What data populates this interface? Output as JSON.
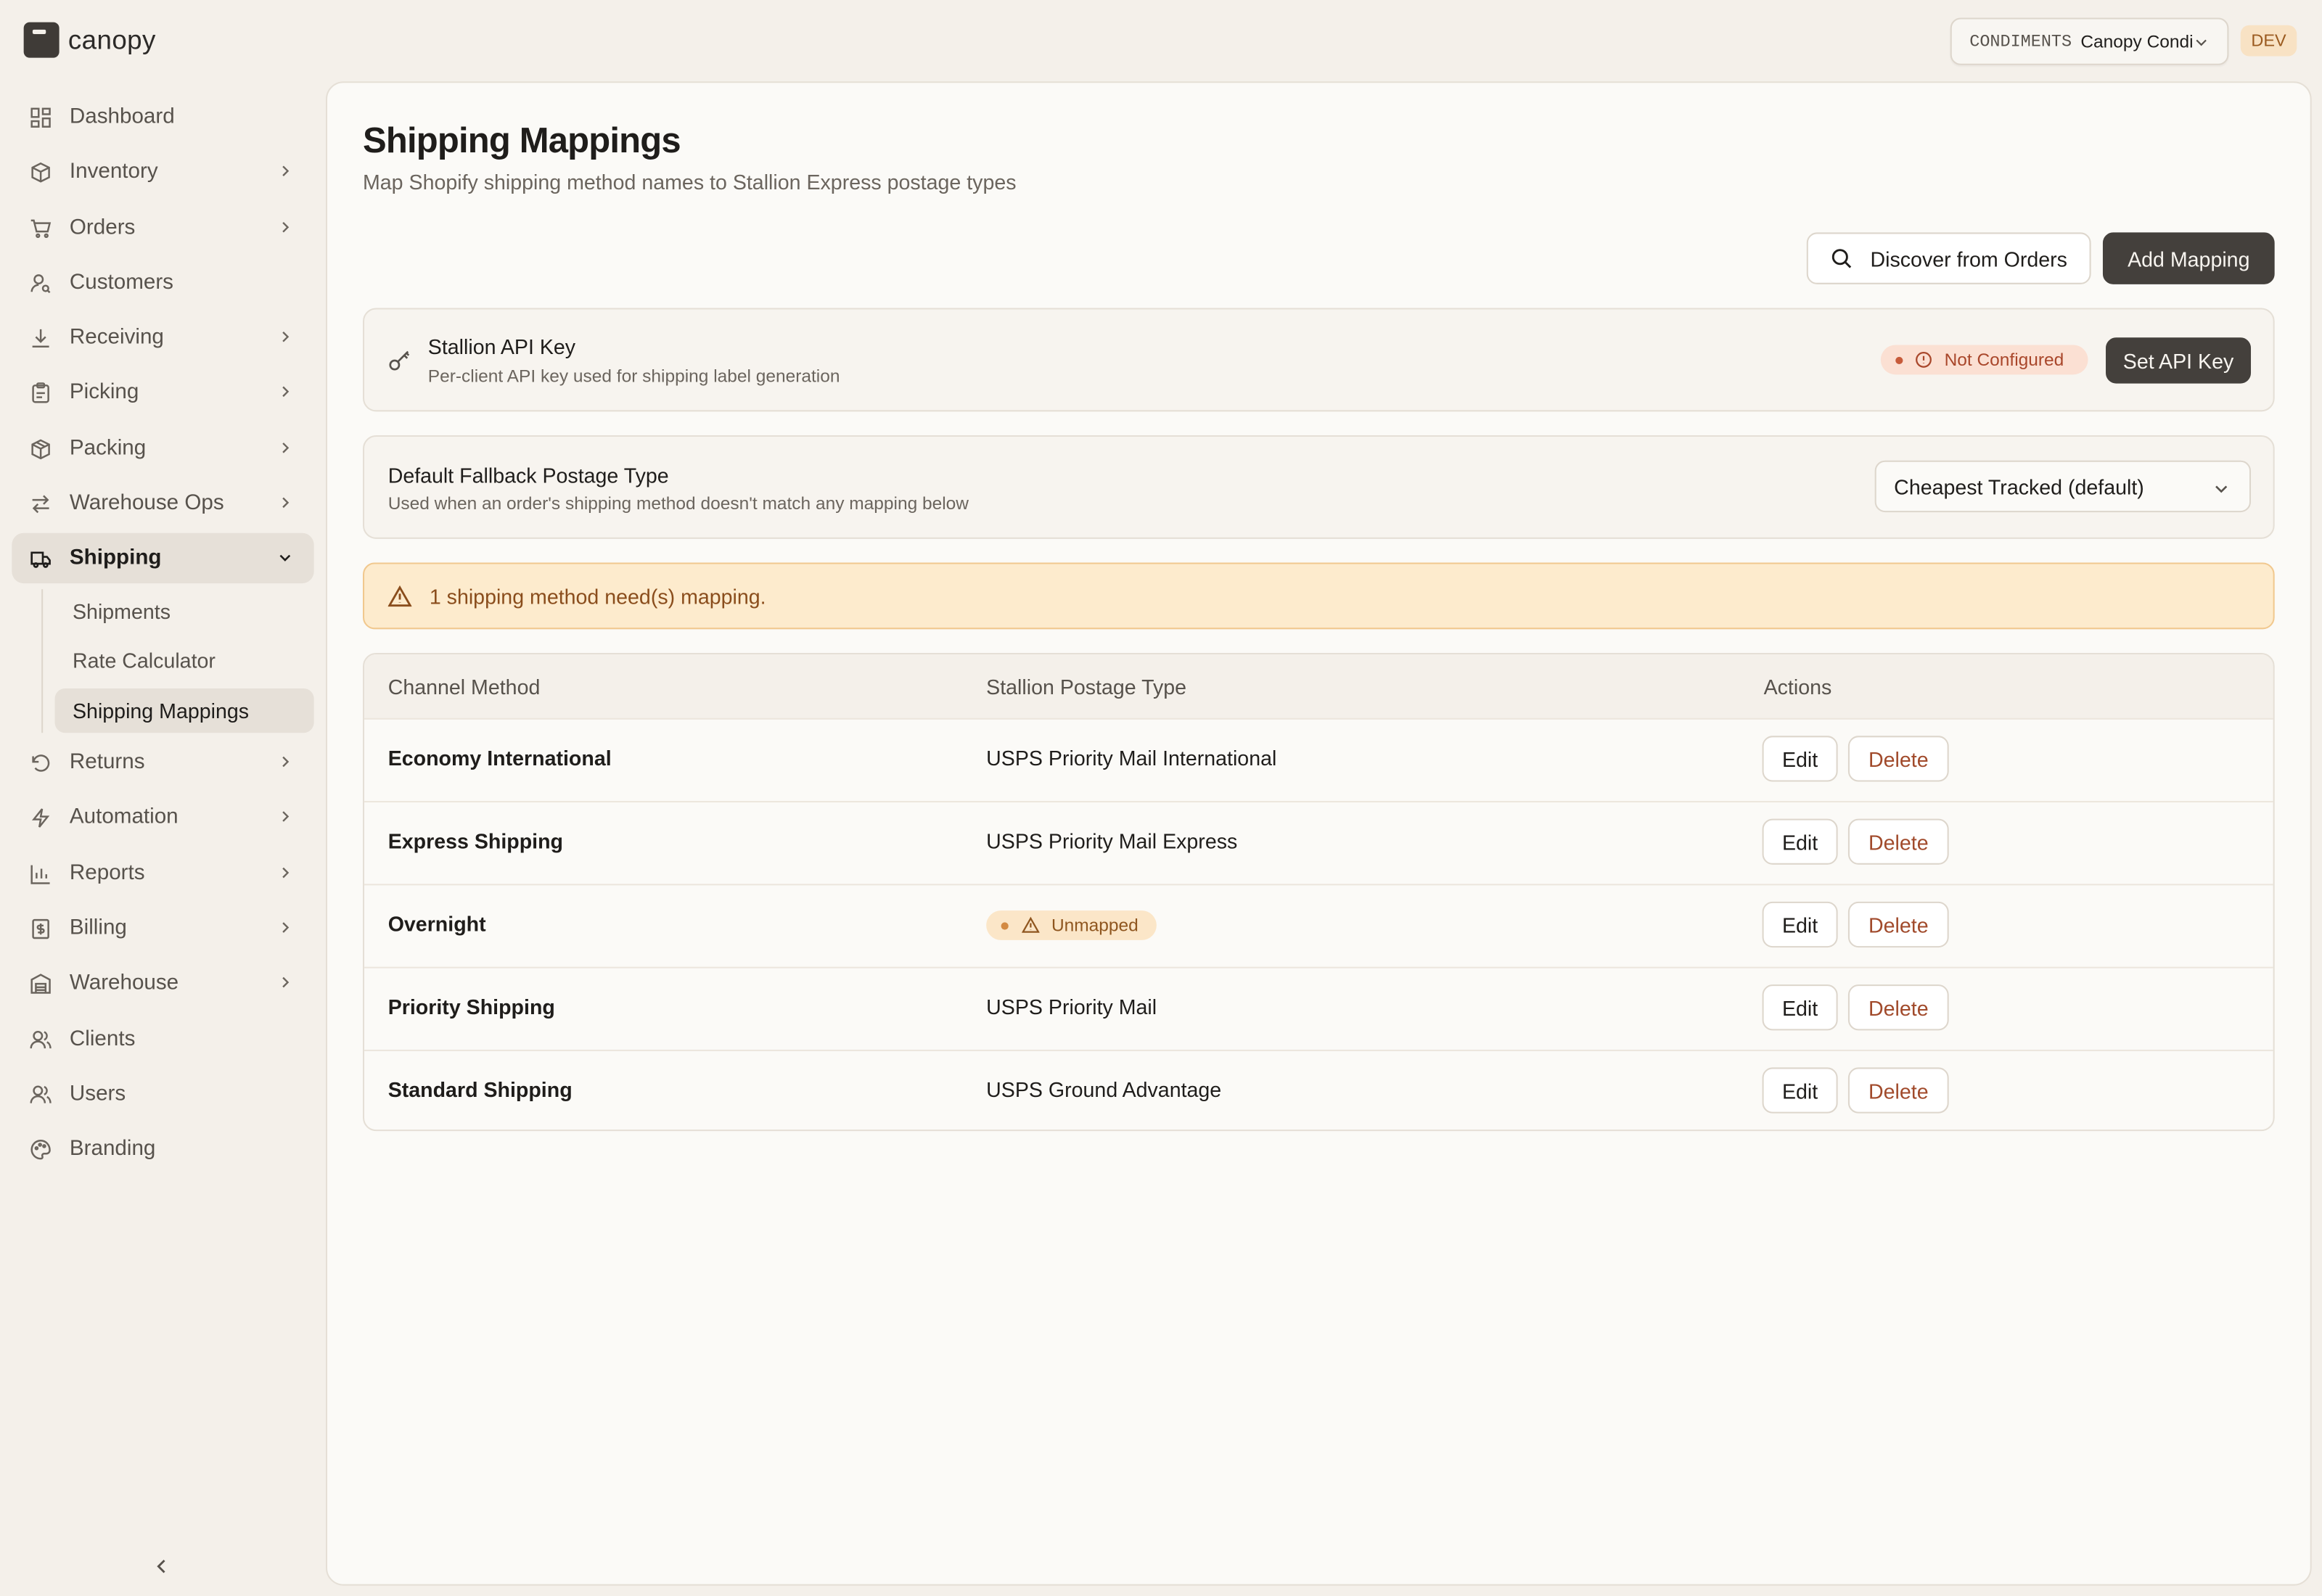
{
  "app": {
    "brand_name": "canopy"
  },
  "topbar": {
    "client_code": "CONDIMENTS",
    "client_name": "Canopy Condiments",
    "env_badge": "DEV"
  },
  "sidebar": {
    "items": [
      {
        "label": "Dashboard",
        "icon": "dashboard-icon",
        "has_chevron": false
      },
      {
        "label": "Inventory",
        "icon": "box-icon",
        "has_chevron": true
      },
      {
        "label": "Orders",
        "icon": "cart-icon",
        "has_chevron": true
      },
      {
        "label": "Customers",
        "icon": "user-search-icon",
        "has_chevron": false
      },
      {
        "label": "Receiving",
        "icon": "download-icon",
        "has_chevron": true
      },
      {
        "label": "Picking",
        "icon": "clipboard-icon",
        "has_chevron": true
      },
      {
        "label": "Packing",
        "icon": "package-icon",
        "has_chevron": true
      },
      {
        "label": "Warehouse Ops",
        "icon": "arrows-icon",
        "has_chevron": true
      },
      {
        "label": "Shipping",
        "icon": "truck-icon",
        "has_chevron": true,
        "active": true,
        "expanded": true
      },
      {
        "label": "Returns",
        "icon": "undo-icon",
        "has_chevron": true
      },
      {
        "label": "Automation",
        "icon": "bolt-icon",
        "has_chevron": true
      },
      {
        "label": "Reports",
        "icon": "bar-chart-icon",
        "has_chevron": true
      },
      {
        "label": "Billing",
        "icon": "receipt-icon",
        "has_chevron": true
      },
      {
        "label": "Warehouse",
        "icon": "warehouse-icon",
        "has_chevron": true
      },
      {
        "label": "Clients",
        "icon": "users-icon",
        "has_chevron": false
      },
      {
        "label": "Users",
        "icon": "users-icon",
        "has_chevron": false
      },
      {
        "label": "Branding",
        "icon": "palette-icon",
        "has_chevron": false
      }
    ],
    "shipping_sub": [
      {
        "label": "Shipments"
      },
      {
        "label": "Rate Calculator"
      },
      {
        "label": "Shipping Mappings",
        "active": true
      }
    ]
  },
  "page": {
    "title": "Shipping Mappings",
    "subtitle": "Map Shopify shipping method names to Stallion Express postage types",
    "discover_label": "Discover from Orders",
    "add_label": "Add Mapping"
  },
  "api_key": {
    "title": "Stallion API Key",
    "description": "Per-client API key used for shipping label generation",
    "status": "Not Configured",
    "button": "Set API Key"
  },
  "fallback": {
    "title": "Default Fallback Postage Type",
    "description": "Used when an order's shipping method doesn't match any mapping below",
    "selected": "Cheapest Tracked (default)"
  },
  "alert": {
    "text": "1 shipping method need(s) mapping."
  },
  "table": {
    "headers": [
      "Channel Method",
      "Stallion Postage Type",
      "Actions"
    ],
    "edit_label": "Edit",
    "delete_label": "Delete",
    "unmapped_label": "Unmapped",
    "rows": [
      {
        "method": "Economy International",
        "postage": "USPS Priority Mail International"
      },
      {
        "method": "Express Shipping",
        "postage": "USPS Priority Mail Express"
      },
      {
        "method": "Overnight",
        "postage": null
      },
      {
        "method": "Priority Shipping",
        "postage": "USPS Priority Mail"
      },
      {
        "method": "Standard Shipping",
        "postage": "USPS Ground Advantage"
      }
    ]
  },
  "colors": {
    "accent": "#44403c",
    "background": "#f4f0ea",
    "warning_bg": "#fdebcd",
    "danger": "#a14a2b"
  }
}
